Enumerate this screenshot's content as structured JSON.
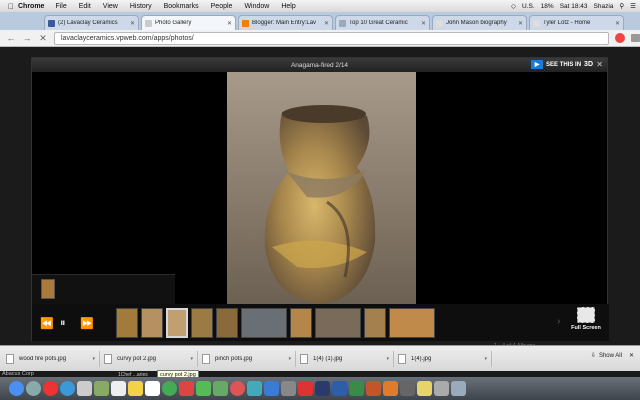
{
  "menubar": {
    "apple": "",
    "app": "Chrome",
    "items": [
      "File",
      "Edit",
      "View",
      "History",
      "Bookmarks",
      "People",
      "Window",
      "Help"
    ],
    "status": [
      "U.S.",
      "18%",
      "Sat 18:43",
      "Shazia"
    ]
  },
  "tabs": [
    {
      "title": "(2) Lavaclay Ceramics",
      "color": "#3b5998"
    },
    {
      "title": "Photo Gallery",
      "color": "#cccccc"
    },
    {
      "title": "Blogger: Main Entry:Lav",
      "color": "#f57d00"
    },
    {
      "title": "Top 10 Great Ceramic",
      "color": "#9ab"
    },
    {
      "title": "John Mason biography",
      "color": "#ddd"
    },
    {
      "title": "Tyler Lotz - Home",
      "color": "#ddd"
    }
  ],
  "toolbar": {
    "url": "lavaclayceramics.vpweb.com/apps/photos/"
  },
  "gallery": {
    "title": "Anagama-fired 2/14",
    "see_this_in": "SEE THIS IN",
    "three_d": "3D",
    "fullscreen_label": "Full Screen",
    "albums_count": "1 - 4 of 4 Albums"
  },
  "downloads": {
    "items": [
      "wood fire pots.jpg",
      "curvy pot 2.jpg",
      "pinch pots.jpg",
      "1(4) (1).jpg",
      "1(4).jpg"
    ],
    "show_all": "Show All",
    "tooltip": "curvy pot 2.jpg"
  },
  "desktop": {
    "left_label": "Abacus Corp",
    "dock_caption": "1Chef ...aries"
  },
  "colors": {
    "accent": "#1e7ad6",
    "page_bg": "#1b1b1b"
  }
}
